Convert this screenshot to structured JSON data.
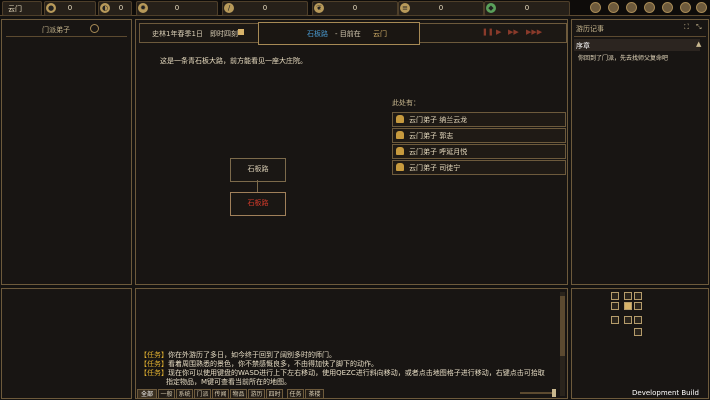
{
  "topbar": {
    "location": "云门",
    "resources": [
      {
        "icon": "coin-icon",
        "value": "0"
      },
      {
        "icon": "food-icon",
        "value": "0"
      },
      {
        "icon": "gear-coin-icon",
        "value": "0"
      },
      {
        "icon": "tool-icon",
        "value": "0"
      },
      {
        "icon": "herb-icon",
        "value": "0"
      },
      {
        "icon": "wood-icon",
        "value": "0"
      },
      {
        "icon": "pot-icon",
        "value": "0"
      }
    ]
  },
  "left_panel": {
    "title": "门派弟子"
  },
  "main": {
    "date": "史林1年春季1日",
    "time_label": "即时四刻",
    "location_left": "石板路",
    "location_sep": "- 目前在",
    "location_right": "云门",
    "description": "这是一条青石板大路，前方能看见一座大庄院。",
    "present_label": "此处有：",
    "npcs": [
      {
        "name": "云门弟子  纳兰云龙"
      },
      {
        "name": "云门弟子  郭志"
      },
      {
        "name": "云门弟子  呼延月悦"
      },
      {
        "name": "云门弟子  司徒宁"
      }
    ],
    "map": {
      "node_top": "石板路",
      "node_bottom": "石板路"
    }
  },
  "right_panel": {
    "title": "游历记事",
    "chapter": "序章",
    "entry": "你回到了门派，先去找师父复命吧"
  },
  "log": {
    "lines": [
      {
        "tag": "【任务】",
        "text": "你在外游历了多日，如今终于回到了阔别多时的师门。"
      },
      {
        "tag": "【任务】",
        "text": "看着周围熟悉的景色，你不禁感慨良多，不由得加快了脚下的动作。"
      },
      {
        "tag": "【任务】",
        "text": "现在你可以使用键盘的WASD进行上下左右移动，使用QEZC进行斜向移动，或者点击地图格子进行移动，右键点击可拾取"
      },
      {
        "tag": "",
        "text": "指定物品，M键可查看当前所在的地图。"
      }
    ],
    "filters": [
      "全部",
      "一般",
      "系统",
      "门派",
      "传闻",
      "物品",
      "游历",
      "四时",
      "任务",
      "茶楼"
    ]
  },
  "footer": {
    "build": "Development Build"
  },
  "colors": {
    "accent": "#d7b36a",
    "border": "#6d5a3c",
    "background": "#151311",
    "alert": "#d23a2a"
  }
}
